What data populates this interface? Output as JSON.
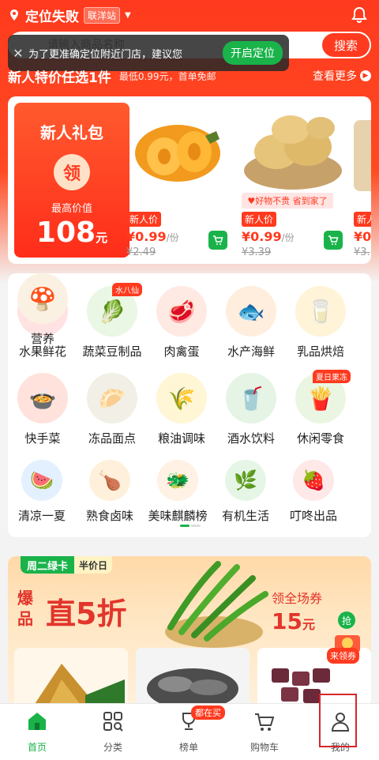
{
  "header": {
    "location": "定位失败",
    "station": "联洋站",
    "search_placeholder": "请输入商品名称",
    "search_button": "搜索"
  },
  "toast": {
    "text": "为了更准确定位附近门店，建议您",
    "button": "开启定位"
  },
  "newuser": {
    "title": "新人特价任选1件",
    "subtitle": "最低0.99元，首单免邮",
    "more": "查看更多"
  },
  "gift": {
    "title": "新人礼包",
    "circle": "领",
    "subtitle": "最高价值",
    "price": "108",
    "unit": "元"
  },
  "products": [
    {
      "tag": "新人价",
      "price": "¥0.99",
      "unit": "/份",
      "old": "¥2.49",
      "banner": ""
    },
    {
      "tag": "新人价",
      "price": "¥0.99",
      "unit": "/份",
      "old": "¥3.39",
      "banner": "好物不贵 省到家了"
    },
    {
      "tag": "新人",
      "price": "¥0",
      "unit": "",
      "old": "¥3.",
      "banner": ""
    }
  ],
  "categories": [
    {
      "label": "水果鲜花",
      "badge": "",
      "color": "#ffe3e3",
      "glyph": "🍉"
    },
    {
      "label": "蔬菜豆制品",
      "badge": "水八仙",
      "color": "#e9f7e4",
      "glyph": "🥬"
    },
    {
      "label": "肉禽蛋",
      "badge": "",
      "color": "#ffe9e3",
      "glyph": "🥩"
    },
    {
      "label": "水产海鲜",
      "badge": "",
      "color": "#ffeede",
      "glyph": "🐟"
    },
    {
      "label": "乳品烘焙",
      "badge": "",
      "color": "#fff4d8",
      "glyph": "🥛"
    },
    {
      "label": "快手菜",
      "badge": "",
      "color": "#ffe2dc",
      "glyph": "🍲"
    },
    {
      "label": "冻品面点",
      "badge": "",
      "color": "#f1efe6",
      "glyph": "🥟"
    },
    {
      "label": "粮油调味",
      "badge": "",
      "color": "#fff6d6",
      "glyph": "🌾"
    },
    {
      "label": "酒水饮料",
      "badge": "",
      "color": "#e5f4e5",
      "glyph": "🥤"
    },
    {
      "label": "休闲零食",
      "badge": "夏日果冻",
      "color": "#eaf6e2",
      "glyph": "🍟"
    },
    {
      "label": "清凉一夏",
      "badge": "",
      "color": "#e3f0ff",
      "glyph": "🍉"
    },
    {
      "label": "熟食卤味",
      "badge": "",
      "color": "#fff0db",
      "glyph": "🍗"
    },
    {
      "label": "美味麒麟榜",
      "badge": "",
      "color": "#fff1e3",
      "glyph": "🐲"
    },
    {
      "label": "有机生活",
      "badge": "",
      "color": "#e6f6e6",
      "glyph": "🌿"
    },
    {
      "label": "叮咚出品",
      "badge": "",
      "color": "#ffe8e8",
      "glyph": "🍓"
    },
    {
      "label": "营养",
      "badge": "",
      "color": "#fbf1e3",
      "glyph": "🍄"
    }
  ],
  "green_card": {
    "badge_green": "周二绿卡",
    "badge_half": "半价日",
    "bao": "爆品",
    "big": "直5折",
    "right_line1": "领全场券",
    "right_price": "15",
    "right_unit": "元",
    "rob": "抢",
    "coupon": "来领券"
  },
  "tabbar": [
    {
      "label": "首页",
      "active": true,
      "badge": ""
    },
    {
      "label": "分类",
      "active": false,
      "badge": ""
    },
    {
      "label": "榜单",
      "active": false,
      "badge": "都在买"
    },
    {
      "label": "购物车",
      "active": false,
      "badge": ""
    },
    {
      "label": "我的",
      "active": false,
      "badge": ""
    }
  ],
  "colors": {
    "brand": "#ff3a1e",
    "green": "#19b34a"
  }
}
